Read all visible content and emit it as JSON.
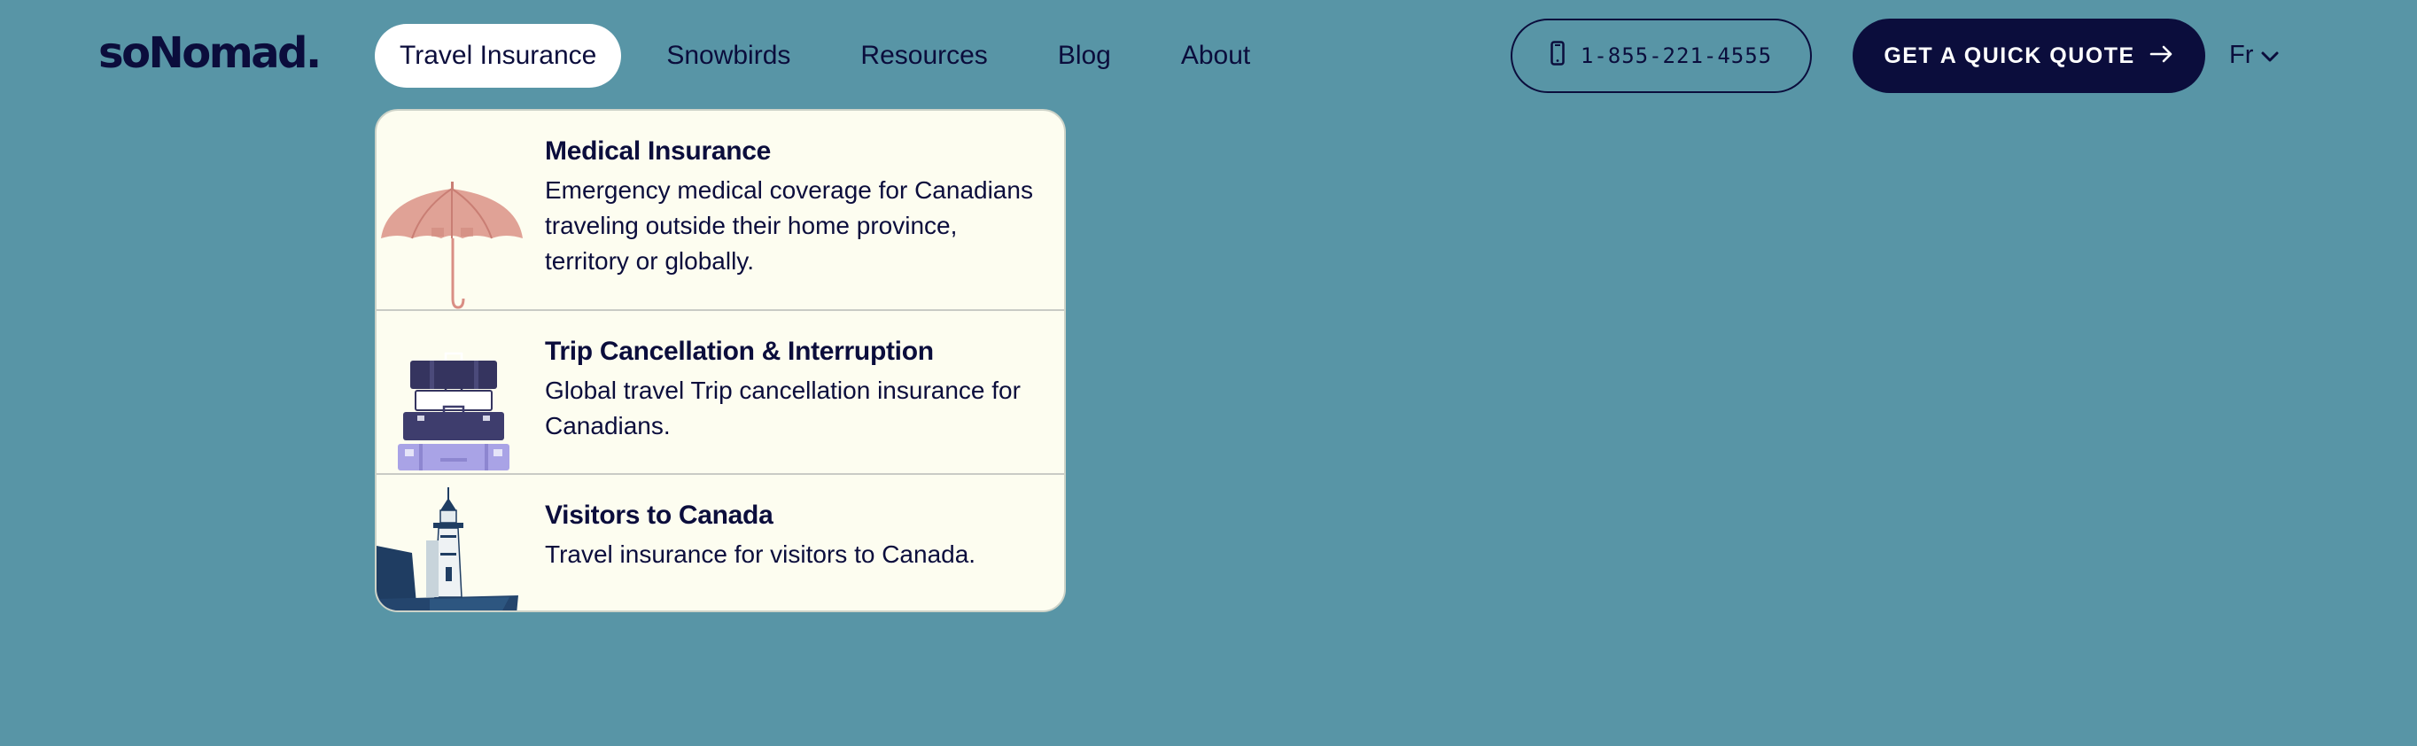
{
  "brand": {
    "logo_text": "soNomad."
  },
  "nav": {
    "items": [
      {
        "label": "Travel Insurance",
        "active": true
      },
      {
        "label": "Snowbirds"
      },
      {
        "label": "Resources"
      },
      {
        "label": "Blog"
      },
      {
        "label": "About"
      }
    ]
  },
  "header": {
    "phone_label": "1-855-221-4555",
    "phone_icon": "phone-icon",
    "quote_label": "GET A QUICK QUOTE",
    "quote_icon": "arrow-right-icon",
    "lang_label": "Fr",
    "lang_icon": "chevron-down-icon"
  },
  "dropdown": {
    "items": [
      {
        "title": "Medical Insurance",
        "desc": "Emergency medical coverage for Canadians traveling outside their home province, territory or globally.",
        "icon": "umbrella-illustration"
      },
      {
        "title": "Trip Cancellation & Interruption",
        "desc": "Global travel Trip cancellation insurance for Canadians.",
        "icon": "suitcases-illustration"
      },
      {
        "title": "Visitors to Canada",
        "desc": "Travel insurance for visitors to Canada.",
        "icon": "lighthouse-illustration"
      }
    ]
  },
  "colors": {
    "background": "#5895a6",
    "navy": "#0b0d3c",
    "dropdown_bg": "#fdfdf0",
    "white": "#ffffff"
  }
}
